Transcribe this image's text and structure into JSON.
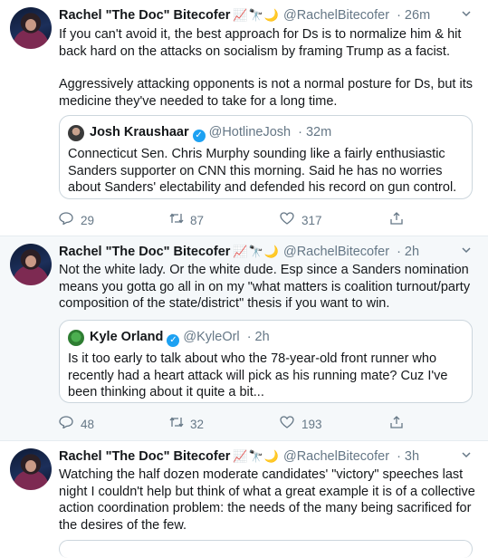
{
  "tweets": [
    {
      "name": "Rachel \"The Doc\" Bitecofer",
      "emoji": "📈🔭🌙",
      "handle": "@RachelBitecofer",
      "time": "· 26m",
      "text1": "If you can't avoid it, the best approach for Ds is to normalize him & hit back hard on the attacks on socialism by framing Trump as a facist.",
      "text2": "Aggressively attacking opponents is not a normal posture for Ds, but its medicine they've needed to take for a long time.",
      "quote": {
        "name": "Josh Kraushaar",
        "handle": "@HotlineJosh",
        "time": "· 32m",
        "text": "Connecticut Sen. Chris Murphy sounding like a fairly enthusiastic Sanders supporter on CNN this morning. Said he has no worries about Sanders' electability and defended his record on gun control."
      },
      "replies": "29",
      "retweets": "87",
      "likes": "317"
    },
    {
      "name": "Rachel \"The Doc\" Bitecofer",
      "emoji": "📈🔭🌙",
      "handle": "@RachelBitecofer",
      "time": "· 2h",
      "text1": "Not the white lady. Or the white dude. Esp since a Sanders nomination means you gotta go all in on my \"what matters is coalition turnout/party composition of the state/district\" thesis if you want to win.",
      "quote": {
        "name": "Kyle Orland",
        "handle": "@KyleOrl",
        "time": "· 2h",
        "text": "Is it too early to talk about who the 78-year-old front runner who recently had a heart attack will pick as his running mate? Cuz I've been thinking about it quite a bit..."
      },
      "replies": "48",
      "retweets": "32",
      "likes": "193"
    },
    {
      "name": "Rachel \"The Doc\" Bitecofer",
      "emoji": "📈🔭🌙",
      "handle": "@RachelBitecofer",
      "time": "· 3h",
      "text1": "Watching the half dozen moderate candidates' \"victory\" speeches last night I couldn't help but think of what a great example it is of a collective action coordination problem: the needs of the many being sacrificed for the desires of the few."
    }
  ],
  "icons": {
    "reply": "reply-icon",
    "retweet": "retweet-icon",
    "like": "heart-icon",
    "share": "share-icon",
    "caret": "chevron-down-icon",
    "verified": "verified-badge-icon"
  },
  "colors": {
    "accent": "#1da1f2",
    "muted": "#657786",
    "border": "#e6ecf0",
    "hover_bg": "#f5f8fa"
  }
}
